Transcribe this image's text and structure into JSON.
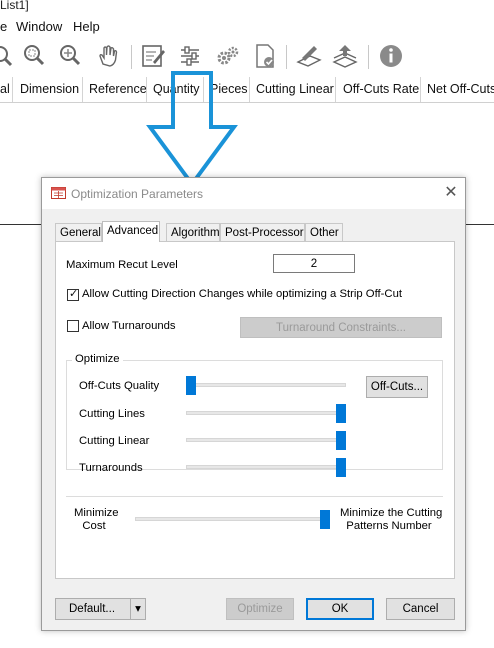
{
  "app": {
    "title_fragment": "List1]",
    "menu": [
      "e",
      "Window",
      "Help"
    ],
    "toolbar_icons": [
      "zoom-in-icon",
      "zoom-fit-icon",
      "zoom-extents-icon",
      "pan-hand-icon",
      "edit-document-icon",
      "sliders-settings-icon",
      "gears-icon",
      "verify-document-icon",
      "cutting-list-icon",
      "stack-export-icon",
      "info-icon"
    ],
    "columns": [
      "al",
      "Dimension",
      "Reference",
      "Quantity",
      "Pieces",
      "Cutting Linear",
      "Off-Cuts Rate",
      "Net Off-Cuts"
    ]
  },
  "annotation": {
    "arrow_color": "#1a93d8"
  },
  "dialog": {
    "title": "Optimization Parameters",
    "close_label": "✕",
    "tabs": [
      "General",
      "Advanced",
      "Algorithm",
      "Post-Processor",
      "Other"
    ],
    "active_tab": "Advanced",
    "max_recut_label": "Maximum Recut Level",
    "max_recut_value": "2",
    "allow_direction_label": "Allow Cutting Direction Changes while optimizing a Strip Off-Cut",
    "allow_direction_checked": true,
    "allow_turnarounds_label": "Allow Turnarounds",
    "allow_turnarounds_checked": false,
    "turnaround_constraints_label": "Turnaround Constraints...",
    "optimize_group_title": "Optimize",
    "sliders": [
      {
        "label": "Off-Cuts Quality",
        "level": 0
      },
      {
        "label": "Cutting Lines",
        "level": 1
      },
      {
        "label": "Cutting Linear",
        "level": 1
      },
      {
        "label": "Turnarounds",
        "level": 1
      }
    ],
    "offcuts_button_label": "Off-Cuts...",
    "minimize_cost_label_1": "Minimize",
    "minimize_cost_label_2": "Cost",
    "minimize_patterns_label_1": "Minimize the Cutting",
    "minimize_patterns_label_2": "Patterns Number",
    "balance_level": 1,
    "default_button_label": "Default...",
    "dropdown_arrow": "▾",
    "optimize_button_label": "Optimize",
    "ok_button_label": "OK",
    "cancel_button_label": "Cancel",
    "accent_color": "#0078d7"
  }
}
